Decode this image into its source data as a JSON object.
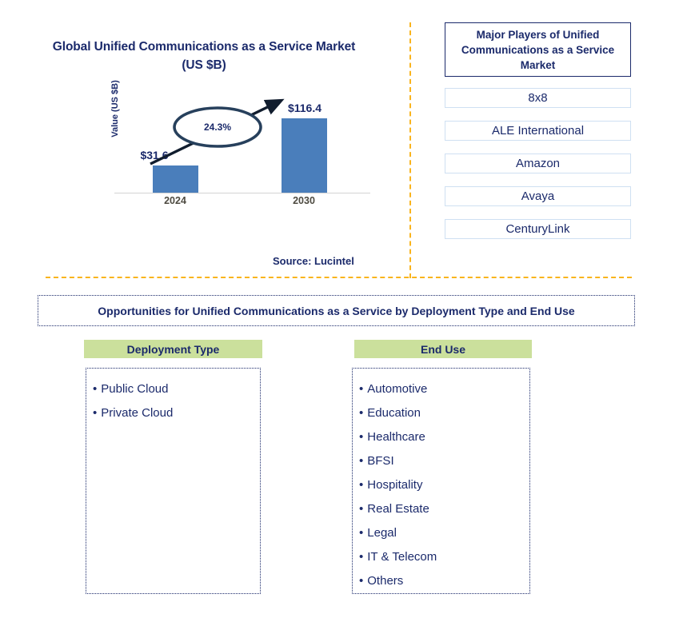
{
  "chart_panel": {
    "title": "Global Unified Communications as a Service Market (US $B)",
    "source": "Source: Lucintel"
  },
  "chart_data": {
    "type": "bar",
    "title": "Global Unified Communications as a Service Market (US $B)",
    "xlabel": "",
    "ylabel": "Value (US $B)",
    "categories": [
      "2024",
      "2030"
    ],
    "values": [
      31.6,
      116.4
    ],
    "value_labels": [
      "$31.6",
      "$116.4"
    ],
    "ylim": [
      0,
      130
    ],
    "grid": false,
    "legend": null,
    "bar_color": "#4a7ebb",
    "annotations": [
      {
        "text": "24.3%",
        "kind": "cagr-callout",
        "shape": "ellipse",
        "from": "2024",
        "to": "2030"
      }
    ]
  },
  "players": {
    "header": "Major Players of Unified Communications as a Service Market",
    "items": [
      {
        "name": "8x8"
      },
      {
        "name": "ALE International"
      },
      {
        "name": "Amazon"
      },
      {
        "name": "Avaya"
      },
      {
        "name": "CenturyLink"
      }
    ]
  },
  "opportunities": {
    "banner": "Opportunities for Unified Communications as a Service by Deployment Type and End Use",
    "columns": [
      {
        "header": "Deployment Type",
        "items": [
          {
            "label": "Public Cloud"
          },
          {
            "label": "Private Cloud"
          }
        ]
      },
      {
        "header": "End Use",
        "items": [
          {
            "label": "Automotive"
          },
          {
            "label": "Education"
          },
          {
            "label": "Healthcare"
          },
          {
            "label": "BFSI"
          },
          {
            "label": "Hospitality"
          },
          {
            "label": "Real Estate"
          },
          {
            "label": "Legal"
          },
          {
            "label": "IT & Telecom"
          },
          {
            "label": "Others"
          }
        ]
      }
    ],
    "bullet": "•"
  },
  "colors": {
    "navy": "#1b2a6b",
    "bar_blue": "#4a7ebb",
    "divider_amber": "#f9b41d",
    "header_green": "#cbe09c",
    "player_border": "#cfe0f2",
    "tick_gray": "#4d4a40"
  }
}
